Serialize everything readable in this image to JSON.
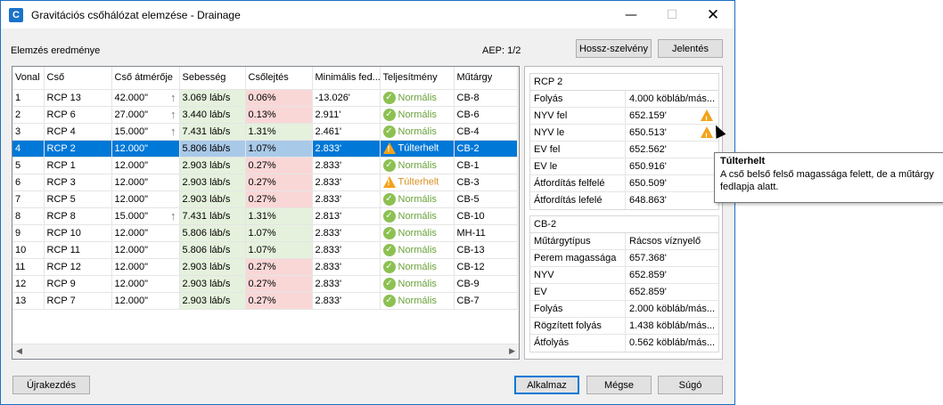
{
  "window": {
    "title": "Gravitációs csőhálózat elemzése - Drainage",
    "app_icon": "C",
    "min_glyph": "—",
    "max_glyph": "☐",
    "close_glyph": "✕"
  },
  "header": {
    "section_label": "Elemzés eredménye",
    "aep": "AEP: 1/2",
    "profile_button": "Hossz-szelvény",
    "report_button": "Jelentés"
  },
  "table": {
    "columns": [
      "Vonal",
      "Cső",
      "Cső átmérője",
      "Sebesség",
      "Csőlejtés",
      "Minimális fed...",
      "Teljesítmény",
      "Műtárgy"
    ],
    "rows": [
      {
        "line": "1",
        "pipe": "RCP 13",
        "diameter": "42.000\"",
        "up": true,
        "velocity": "3.069 láb/s",
        "slope": "0.06%",
        "slope_bad": true,
        "cover": "-13.026'",
        "status": "Normális",
        "status_ok": true,
        "structure": "CB-8"
      },
      {
        "line": "2",
        "pipe": "RCP 6",
        "diameter": "27.000\"",
        "up": true,
        "velocity": "3.440 láb/s",
        "slope": "0.13%",
        "slope_bad": true,
        "cover": "2.911'",
        "status": "Normális",
        "status_ok": true,
        "structure": "CB-6"
      },
      {
        "line": "3",
        "pipe": "RCP 4",
        "diameter": "15.000\"",
        "up": true,
        "velocity": "7.431 láb/s",
        "slope": "1.31%",
        "slope_bad": false,
        "cover": "2.461'",
        "status": "Normális",
        "status_ok": true,
        "structure": "CB-4"
      },
      {
        "line": "4",
        "pipe": "RCP 2",
        "diameter": "12.000\"",
        "up": false,
        "velocity": "5.806 láb/s",
        "slope": "1.07%",
        "slope_bad": false,
        "cover": "2.833'",
        "status": "Túlterhelt",
        "status_ok": false,
        "structure": "CB-2",
        "selected": true
      },
      {
        "line": "5",
        "pipe": "RCP 1",
        "diameter": "12.000\"",
        "up": false,
        "velocity": "2.903 láb/s",
        "slope": "0.27%",
        "slope_bad": true,
        "cover": "2.833'",
        "status": "Normális",
        "status_ok": true,
        "structure": "CB-1"
      },
      {
        "line": "6",
        "pipe": "RCP 3",
        "diameter": "12.000\"",
        "up": false,
        "velocity": "2.903 láb/s",
        "slope": "0.27%",
        "slope_bad": true,
        "cover": "2.833'",
        "status": "Túlterhelt",
        "status_ok": false,
        "structure": "CB-3"
      },
      {
        "line": "7",
        "pipe": "RCP 5",
        "diameter": "12.000\"",
        "up": false,
        "velocity": "2.903 láb/s",
        "slope": "0.27%",
        "slope_bad": true,
        "cover": "2.833'",
        "status": "Normális",
        "status_ok": true,
        "structure": "CB-5"
      },
      {
        "line": "8",
        "pipe": "RCP 8",
        "diameter": "15.000\"",
        "up": true,
        "velocity": "7.431 láb/s",
        "slope": "1.31%",
        "slope_bad": false,
        "cover": "2.813'",
        "status": "Normális",
        "status_ok": true,
        "structure": "CB-10"
      },
      {
        "line": "9",
        "pipe": "RCP 10",
        "diameter": "12.000\"",
        "up": false,
        "velocity": "5.806 láb/s",
        "slope": "1.07%",
        "slope_bad": false,
        "cover": "2.833'",
        "status": "Normális",
        "status_ok": true,
        "structure": "MH-11"
      },
      {
        "line": "10",
        "pipe": "RCP 11",
        "diameter": "12.000\"",
        "up": false,
        "velocity": "5.806 láb/s",
        "slope": "1.07%",
        "slope_bad": false,
        "cover": "2.833'",
        "status": "Normális",
        "status_ok": true,
        "structure": "CB-13"
      },
      {
        "line": "11",
        "pipe": "RCP 12",
        "diameter": "12.000\"",
        "up": false,
        "velocity": "2.903 láb/s",
        "slope": "0.27%",
        "slope_bad": true,
        "cover": "2.833'",
        "status": "Normális",
        "status_ok": true,
        "structure": "CB-12"
      },
      {
        "line": "12",
        "pipe": "RCP 9",
        "diameter": "12.000\"",
        "up": false,
        "velocity": "2.903 láb/s",
        "slope": "0.27%",
        "slope_bad": true,
        "cover": "2.833'",
        "status": "Normális",
        "status_ok": true,
        "structure": "CB-9"
      },
      {
        "line": "13",
        "pipe": "RCP 7",
        "diameter": "12.000\"",
        "up": false,
        "velocity": "2.903 láb/s",
        "slope": "0.27%",
        "slope_bad": true,
        "cover": "2.833'",
        "status": "Normális",
        "status_ok": true,
        "structure": "CB-7"
      }
    ]
  },
  "pipe_props": {
    "title": "RCP 2",
    "rows": [
      {
        "k": "Folyás",
        "v": "4.000 köbláb/más...",
        "warn": false
      },
      {
        "k": "NYV fel",
        "v": "652.159'",
        "warn": true
      },
      {
        "k": "NYV le",
        "v": "650.513'",
        "warn": true
      },
      {
        "k": "EV fel",
        "v": "652.562'",
        "warn": false
      },
      {
        "k": "EV le",
        "v": "650.916'",
        "warn": false
      },
      {
        "k": "Átfordítás felfelé",
        "v": "650.509'",
        "warn": false
      },
      {
        "k": "Átfordítás lefelé",
        "v": "648.863'",
        "warn": false
      }
    ]
  },
  "structure_props": {
    "title": "CB-2",
    "rows": [
      {
        "k": "Műtárgytípus",
        "v": "Rácsos víznyelő"
      },
      {
        "k": "Perem magassága",
        "v": "657.368'"
      },
      {
        "k": "NYV",
        "v": "652.859'"
      },
      {
        "k": "EV",
        "v": "652.859'"
      },
      {
        "k": "Folyás",
        "v": "2.000 köbláb/más..."
      },
      {
        "k": "Rögzített folyás",
        "v": "1.438 köbláb/más..."
      },
      {
        "k": "Átfolyás",
        "v": "0.562 köbláb/más..."
      }
    ]
  },
  "tooltip": {
    "title": "Túlterhelt",
    "body": "A cső belső felső magassága felett, de a műtárgy fedlapja alatt."
  },
  "footer": {
    "reset_button": "Újrakezdés",
    "apply_button": "Alkalmaz",
    "cancel_button": "Mégse",
    "help_button": "Súgó"
  },
  "colors": {
    "accent": "#0078d7",
    "ok_green": "#8cc152",
    "warn_orange": "#f4a21b",
    "good_cell": "#e5f1dd",
    "bad_cell": "#fad7d7"
  },
  "icons": {
    "ok": "check-circle-icon",
    "warn": "warning-triangle-icon",
    "up": "arrow-up-icon"
  }
}
